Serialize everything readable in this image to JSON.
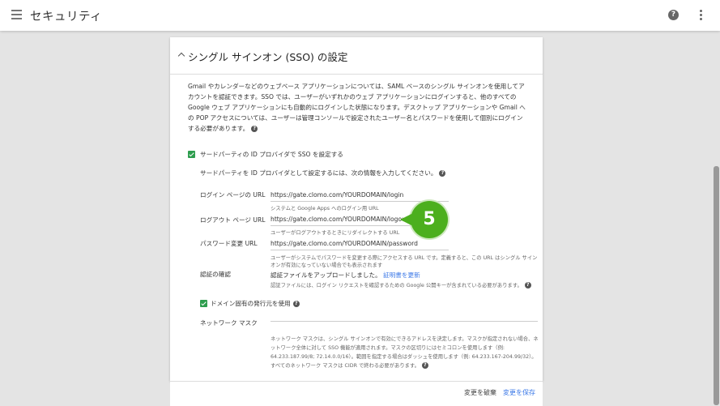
{
  "appbar": {
    "title": "セキュリティ",
    "menu_icon": "menu-icon",
    "help_icon": "help-icon",
    "help_glyph": "?",
    "more_icon": "more-vert-icon"
  },
  "section": {
    "title": "シングル サインオン (SSO) の設定",
    "description": "Gmail やカレンダーなどのウェブベース アプリケーションについては、SAML ベースのシングル サインオンを使用してアカウントを認証できます。SSO では、ユーザーがいずれかのウェブ アプリケーションにログインすると、他のすべての Google ウェブ アプリケーションにも自動的にログインした状態になります。デスクトップ アプリケーションや Gmail への POP アクセスについては、ユーザーは管理コンソールで設定されたユーザー名とパスワードを使用して個別にログインする必要があります。"
  },
  "sso": {
    "enable_label": "サードパーティの ID プロバイダで SSO を設定する",
    "enable_checked": true,
    "instructions": "サードパーティを ID プロバイダとして設定するには、次の情報を入力してください。",
    "login_label": "ログイン ページの URL",
    "login_value": "https://gate.clomo.com/YOURDOMAIN/login",
    "login_hint": "システムと Google Apps へのログイン用 URL",
    "logout_label": "ログアウト ページ URL",
    "logout_value": "https://gate.clomo.com/YOURDOMAIN/logout",
    "logout_hint": "ユーザーがログアウトするときにリダイレクトする URL",
    "password_label": "パスワード変更 URL",
    "password_value": "https://gate.clomo.com/YOURDOMAIN/password",
    "password_hint": "ユーザーがシステムでパスワードを変更する際にアクセスする URL です。定義すると、この URL はシングル サインオンが有効になっていない場合でも表示されます",
    "cert_label": "認証の確認",
    "cert_text": "認証ファイルをアップロードしました。",
    "cert_link": "証明書を更新",
    "cert_hint": "認証ファイルには、ログイン リクエストを確認するための Google 公開キーが含まれている必要があります。",
    "domain_issuer_label": "ドメイン固有の発行元を使用",
    "domain_issuer_checked": true,
    "netmask_label": "ネットワーク マスク",
    "netmask_value": "",
    "netmask_hint": "ネットワーク マスクは、シングル サインオンで有効にできるアドレスを決定します。マスクが指定されない場合、ネットワーク全体に対して SSO 機能が適用されます。マスクの区切りにはセミコロンを使用します（例: 64.233.187.99/8; 72.14.0.0/16）。範囲を指定する場合はダッシュを使用します（例: 64.233.167-204.99/32）。すべてのネットワーク マスクは CIDR で終わる必要があります。"
  },
  "footer": {
    "discard": "変更を破棄",
    "save": "変更を保存"
  },
  "callout": {
    "number": "5"
  },
  "colors": {
    "accent": "#3b78e7",
    "checkbox": "#2e9d4e",
    "callout": "#4caf1e"
  }
}
